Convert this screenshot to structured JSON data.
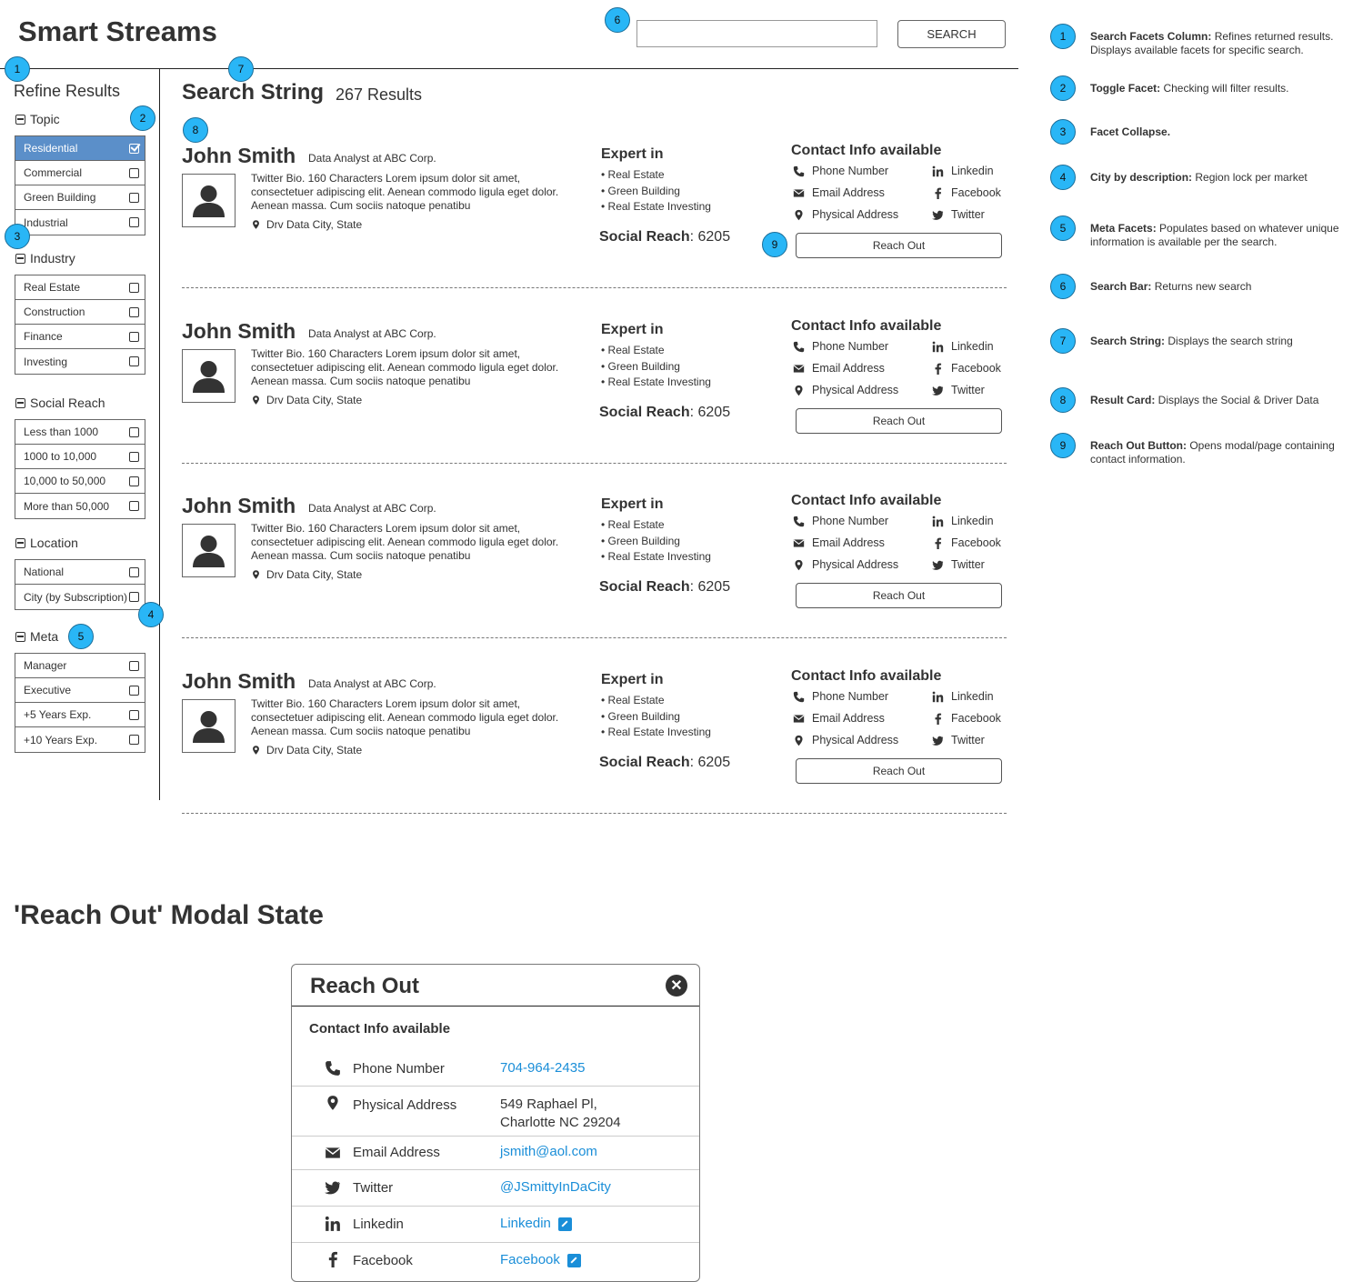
{
  "app": {
    "title": "Smart Streams"
  },
  "search": {
    "placeholder": "",
    "button_label": "SEARCH"
  },
  "badges": {
    "b1": "1",
    "b2": "2",
    "b3": "3",
    "b4": "4",
    "b5": "5",
    "b6": "6",
    "b7": "7",
    "b8": "8",
    "b9": "9"
  },
  "sidebar": {
    "title": "Refine Results",
    "facets": [
      {
        "name": "Topic",
        "items": [
          {
            "label": "Residential",
            "checked": true
          },
          {
            "label": "Commercial",
            "checked": false
          },
          {
            "label": "Green Building",
            "checked": false
          },
          {
            "label": "Industrial",
            "checked": false
          }
        ]
      },
      {
        "name": "Industry",
        "items": [
          {
            "label": "Real Estate",
            "checked": false
          },
          {
            "label": "Construction",
            "checked": false
          },
          {
            "label": "Finance",
            "checked": false
          },
          {
            "label": "Investing",
            "checked": false
          }
        ]
      },
      {
        "name": "Social Reach",
        "items": [
          {
            "label": "Less than 1000",
            "checked": false
          },
          {
            "label": "1000 to 10,000",
            "checked": false
          },
          {
            "label": "10,000 to 50,000",
            "checked": false
          },
          {
            "label": "More than 50,000",
            "checked": false
          }
        ]
      },
      {
        "name": "Location",
        "items": [
          {
            "label": "National",
            "checked": false
          },
          {
            "label": "City (by Subscription)",
            "checked": false
          }
        ]
      },
      {
        "name": "Meta",
        "items": [
          {
            "label": "Manager",
            "checked": false
          },
          {
            "label": "Executive",
            "checked": false
          },
          {
            "label": "+5 Years Exp.",
            "checked": false
          },
          {
            "label": "+10 Years Exp.",
            "checked": false
          }
        ]
      }
    ]
  },
  "main": {
    "search_string": "Search String",
    "result_count": "267 Results"
  },
  "result": {
    "name": "John Smith",
    "job_title": "Data Analyst at ABC Corp.",
    "bio": "Twitter Bio. 160 Characters Lorem ipsum dolor sit amet, consectetuer adipiscing elit. Aenean commodo ligula eget dolor. Aenean massa. Cum sociis natoque penatibu",
    "location": "Drv Data City, State",
    "expert_heading": "Expert in",
    "expert_items": [
      "• Real Estate",
      "• Green Building",
      "• Real Estate Investing"
    ],
    "social_reach_label": "Social Reach",
    "social_reach_value": ": 6205",
    "contact_heading": "Contact Info available",
    "contact": {
      "phone": "Phone Number",
      "email": "Email Address",
      "address": "Physical Address",
      "linkedin": "Linkedin",
      "facebook": "Facebook",
      "twitter": "Twitter"
    },
    "button": "Reach Out"
  },
  "legend": [
    {
      "num": "1",
      "title": "Search Facets Column:",
      "text": " Refines returned results. Displays available facets for specific search."
    },
    {
      "num": "2",
      "title": "Toggle Facet:",
      "text": " Checking will filter results."
    },
    {
      "num": "3",
      "title": "Facet Collapse.",
      "text": ""
    },
    {
      "num": "4",
      "title": "City by description:",
      "text": " Region lock per market"
    },
    {
      "num": "5",
      "title": "Meta Facets:",
      "text": " Populates based on whatever unique information is available per the search."
    },
    {
      "num": "6",
      "title": "Search Bar:",
      "text": " Returns new search"
    },
    {
      "num": "7",
      "title": "Search String:",
      "text": " Displays the search string"
    },
    {
      "num": "8",
      "title": "Result Card:",
      "text": " Displays the Social & Driver Data"
    },
    {
      "num": "9",
      "title": "Reach Out Button:",
      "text": " Opens modal/page containing contact information."
    }
  ],
  "modal_section": {
    "heading": "'Reach Out' Modal State"
  },
  "modal": {
    "title": "Reach Out",
    "subtitle": "Contact Info available",
    "rows": {
      "phone": {
        "label": "Phone Number",
        "value": "704-964-2435"
      },
      "address": {
        "label": "Physical Address",
        "line1": "549 Raphael Pl,",
        "line2": "Charlotte NC 29204"
      },
      "email": {
        "label": "Email Address",
        "value": "jsmith@aol.com"
      },
      "twitter": {
        "label": "Twitter",
        "value": "@JSmittyInDaCity"
      },
      "linkedin": {
        "label": "Linkedin",
        "value": "Linkedin"
      },
      "facebook": {
        "label": "Facebook",
        "value": "Facebook"
      }
    }
  },
  "colors": {
    "accent": "#29b6f6",
    "selected": "#5b8fc9",
    "link": "#1a8ed8"
  }
}
